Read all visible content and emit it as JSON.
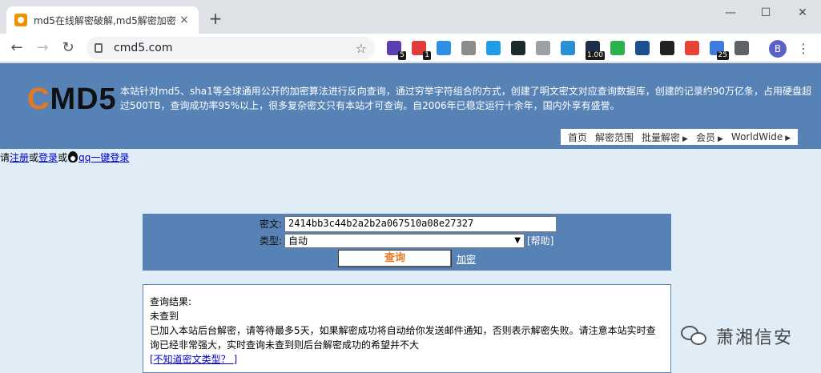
{
  "browser": {
    "tab_title": "md5在线解密破解,md5解密加密",
    "tab_close": "×",
    "new_tab": "+",
    "url": "cmd5.com",
    "extensions": [
      {
        "color": "#5b3fb3",
        "badge": "5"
      },
      {
        "color": "#e23b3b",
        "badge": "1"
      },
      {
        "color": "#2f8ee5",
        "badge": ""
      },
      {
        "color": "#8c8c8c",
        "badge": ""
      },
      {
        "color": "#1f9de8",
        "badge": ""
      },
      {
        "color": "#1d2b2b",
        "badge": ""
      },
      {
        "color": "#9aa0a6",
        "badge": ""
      },
      {
        "color": "#2b8fd6",
        "badge": ""
      },
      {
        "color": "#1e2e4a",
        "badge": "1.00"
      },
      {
        "color": "#2bb24c",
        "badge": ""
      },
      {
        "color": "#1d4f91",
        "badge": ""
      },
      {
        "color": "#222222",
        "badge": ""
      },
      {
        "color": "#ea4335",
        "badge": ""
      },
      {
        "color": "#3f7be0",
        "badge": "25"
      },
      {
        "color": "#5f6368",
        "badge": ""
      }
    ],
    "profile_initial": "B"
  },
  "site": {
    "logo_c": "C",
    "logo_rest": "MD5",
    "intro": "本站针对md5、sha1等全球通用公开的加密算法进行反向查询，通过穷举字符组合的方式，创建了明文密文对应查询数据库，创建的记录约90万亿条，占用硬盘超过500TB，查询成功率95%以上，很多复杂密文只有本站才可查询。自2006年已稳定运行十余年，国内外享有盛誉。",
    "nav": [
      {
        "label": "首页",
        "arrow": ""
      },
      {
        "label": "解密范围",
        "arrow": ""
      },
      {
        "label": "批量解密",
        "arrow": "▶"
      },
      {
        "label": "会员",
        "arrow": "▶"
      },
      {
        "label": "WorldWide",
        "arrow": "▶"
      }
    ],
    "login": {
      "prefix": "请",
      "register": "注册",
      "or1": "或",
      "login": "登录",
      "or2": "或",
      "qq_login": "qq一键登录"
    }
  },
  "form": {
    "cipher_label": "密文:",
    "cipher_value": "2414bb3c44b2a2b2a067510a08e27327",
    "type_label": "类型:",
    "type_value": "自动",
    "help": "[帮助]",
    "query_button": "查询",
    "encrypt_link": "加密"
  },
  "result": {
    "heading": "查询结果:",
    "status": "未查到",
    "message": "已加入本站后台解密，请等待最多5天，如果解密成功将自动给你发送邮件通知，否则表示解密失败。请注意本站实时查询已经非常强大，实时查询未查到则后台解密成功的希望并不大",
    "link": "[不知道密文类型？ ]"
  },
  "watermark": "萧湘信安"
}
